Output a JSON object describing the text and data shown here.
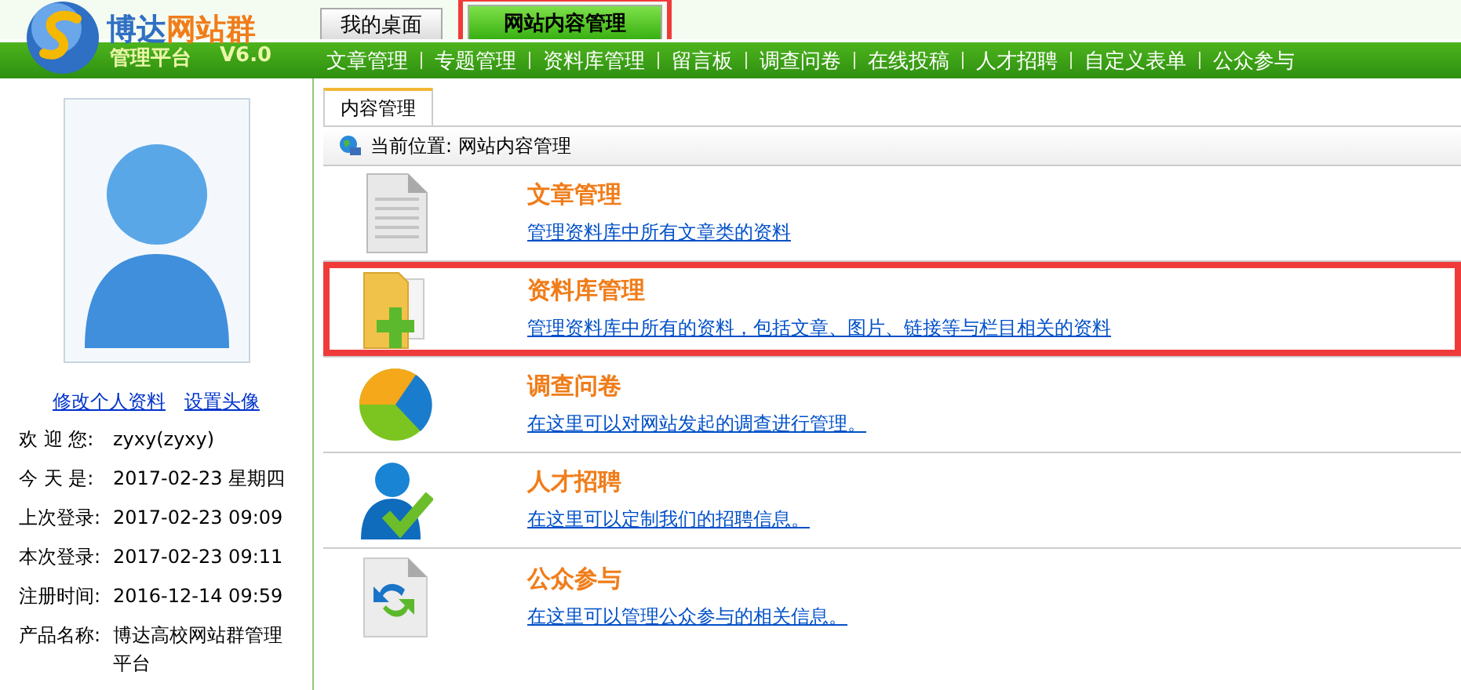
{
  "brand": {
    "parts": [
      {
        "text": "博达",
        "color": "#2f6fc4"
      },
      {
        "text": "网站群",
        "color": "#f07d1a"
      }
    ],
    "subtitle": "管理平台",
    "version": "V6.0"
  },
  "top_tabs": [
    {
      "label": "我的桌面",
      "selected": false,
      "highlighted": false
    },
    {
      "label": "网站内容管理",
      "selected": true,
      "highlighted": true
    }
  ],
  "nav": [
    "文章管理",
    "专题管理",
    "资料库管理",
    "留言板",
    "调查问卷",
    "在线投稿",
    "人才招聘",
    "自定义表单",
    "公众参与"
  ],
  "profile": {
    "links": [
      "修改个人资料",
      "设置头像"
    ],
    "rows": [
      {
        "label": "欢 迎 您:",
        "value": "zyxy(zyxy)"
      },
      {
        "label": "今 天 是:",
        "value": "2017-02-23 星期四"
      },
      {
        "label": "上次登录:",
        "value": "2017-02-23 09:09"
      },
      {
        "label": "本次登录:",
        "value": "2017-02-23 09:11"
      },
      {
        "label": "注册时间:",
        "value": "2016-12-14 09:59"
      },
      {
        "label": "产品名称:",
        "value": "博达高校网站群管理平台"
      }
    ]
  },
  "content_tab": {
    "label": "内容管理",
    "selected": true
  },
  "breadcrumb": "当前位置: 网站内容管理",
  "items": [
    {
      "kind": "document",
      "title": "文章管理",
      "description": "管理资料库中所有文章类的资料",
      "highlighted": false
    },
    {
      "kind": "folder",
      "title": "资料库管理",
      "description": "管理资料库中所有的资料，包括文章、图片、链接等与栏目相关的资料",
      "highlighted": true
    },
    {
      "kind": "survey",
      "title": "调查问卷",
      "description": "在这里可以对网站发起的调查进行管理。",
      "highlighted": false
    },
    {
      "kind": "recruit",
      "title": "人才招聘",
      "description": "在这里可以定制我们的招聘信息。",
      "highlighted": false
    },
    {
      "kind": "exchange",
      "title": "公众参与",
      "description": "在这里可以管理公众参与的相关信息。",
      "highlighted": false
    }
  ]
}
